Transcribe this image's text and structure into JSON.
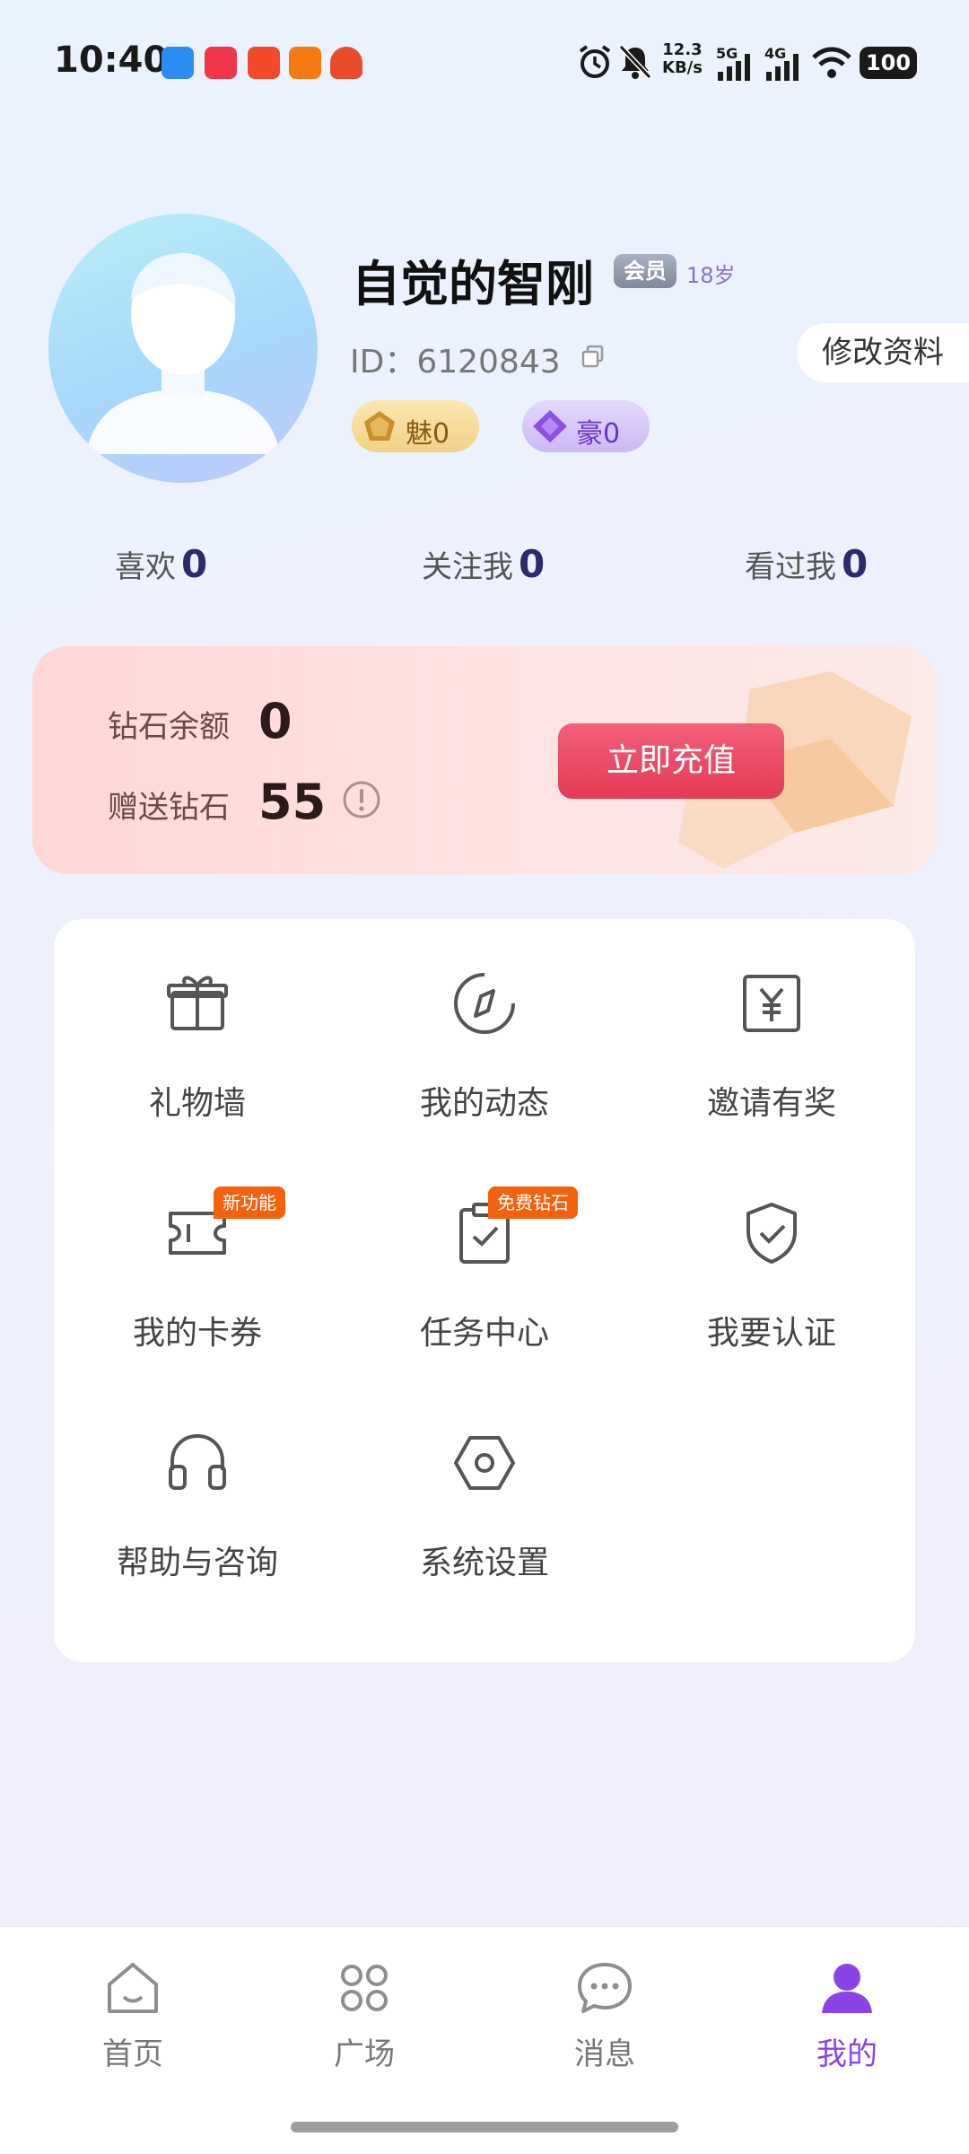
{
  "status_bar": {
    "time": "10:40",
    "net_speed_value": "12.3",
    "net_speed_unit": "KB/s",
    "signal_1": "5G",
    "signal_2": "4G",
    "battery": "100",
    "notification_icons": [
      "app-icon-blue",
      "app-icon-xiaohongshu",
      "app-icon-taobao",
      "app-icon-orange",
      "app-icon-red"
    ]
  },
  "profile": {
    "username": "自觉的智刚",
    "member_badge": "会员",
    "age": "18岁",
    "id_text": "ID：6120843",
    "edit_label": "修改资料",
    "charm_label": "魅0",
    "wealth_label": "豪0"
  },
  "stats": [
    {
      "label": "喜欢",
      "value": "0"
    },
    {
      "label": "关注我",
      "value": "0"
    },
    {
      "label": "看过我",
      "value": "0"
    }
  ],
  "diamond": {
    "balance_label": "钻石余额",
    "balance_value": "0",
    "gift_label": "赠送钻石",
    "gift_value": "55",
    "recharge_label": "立即充值"
  },
  "menu": [
    {
      "label": "礼物墙",
      "icon": "gift-icon"
    },
    {
      "label": "我的动态",
      "icon": "compass-icon"
    },
    {
      "label": "邀请有奖",
      "icon": "yuan-icon"
    },
    {
      "label": "我的卡券",
      "icon": "ticket-icon",
      "tag": "新功能"
    },
    {
      "label": "任务中心",
      "icon": "clipboard-check-icon",
      "tag": "免费钻石"
    },
    {
      "label": "我要认证",
      "icon": "shield-check-icon"
    },
    {
      "label": "帮助与咨询",
      "icon": "headphones-icon"
    },
    {
      "label": "系统设置",
      "icon": "settings-icon"
    }
  ],
  "tabs": [
    {
      "label": "首页",
      "icon": "home-icon"
    },
    {
      "label": "广场",
      "icon": "grid-icon"
    },
    {
      "label": "消息",
      "icon": "chat-icon"
    },
    {
      "label": "我的",
      "icon": "user-icon",
      "active": true
    }
  ],
  "colors": {
    "accent": "#8b42e8",
    "recharge": "#e43a55",
    "tag": "#f2620f"
  }
}
